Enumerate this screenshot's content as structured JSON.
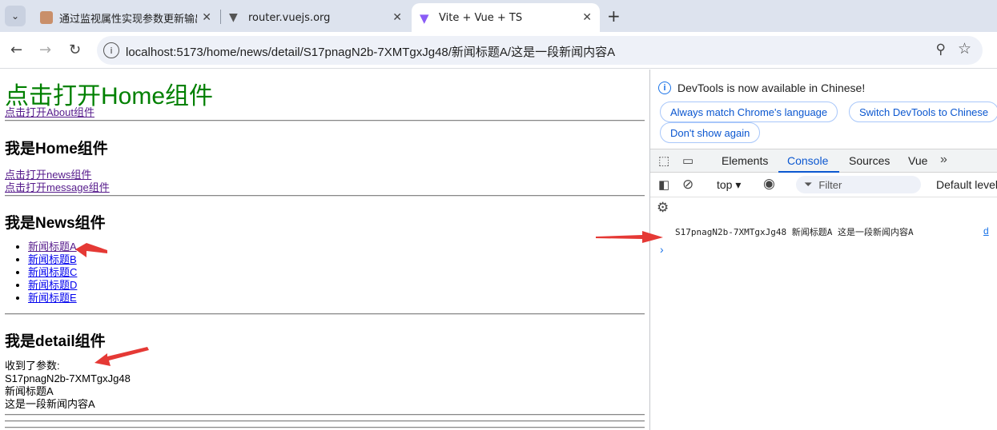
{
  "browser": {
    "tabs": [
      {
        "title": "通过监视属性实现参数更新输出",
        "active": false
      },
      {
        "title": "router.vuejs.org",
        "active": false
      },
      {
        "title": "Vite + Vue + TS",
        "active": true
      }
    ],
    "url": "localhost:5173/home/news/detail/S17pnagN2b-7XMTgxJg48/新闻标题A/这是一段新闻内容A"
  },
  "page": {
    "home_link": "点击打开Home组件",
    "about_link": "点击打开About组件",
    "home_heading": "我是Home组件",
    "news_link": "点击打开news组件",
    "message_link": "点击打开message组件",
    "news_heading": "我是News组件",
    "news_items": [
      "新闻标题A",
      "新闻标题B",
      "新闻标题C",
      "新闻标题D",
      "新闻标题E"
    ],
    "detail_heading": "我是detail组件",
    "received_label": "收到了参数:",
    "param_id": "S17pnagN2b-7XMTgxJg48",
    "param_title": "新闻标题A",
    "param_content": "这是一段新闻内容A"
  },
  "devtools": {
    "banner_text": "DevTools is now available in Chinese!",
    "btn_match": "Always match Chrome's language",
    "btn_switch": "Switch DevTools to Chinese",
    "btn_dont_show": "Don't show again",
    "tabs": [
      "Elements",
      "Console",
      "Sources",
      "Vue"
    ],
    "active_tab": "Console",
    "context": "top",
    "filter_placeholder": "Filter",
    "levels": "Default levels",
    "log_message": "S17pnagN2b-7XMTgxJg48 新闻标题A 这是一段新闻内容A",
    "log_source": "d"
  },
  "colors": {
    "accent": "#0b57d0",
    "home_link": "#008000",
    "annotation_arrow": "#e53935"
  }
}
